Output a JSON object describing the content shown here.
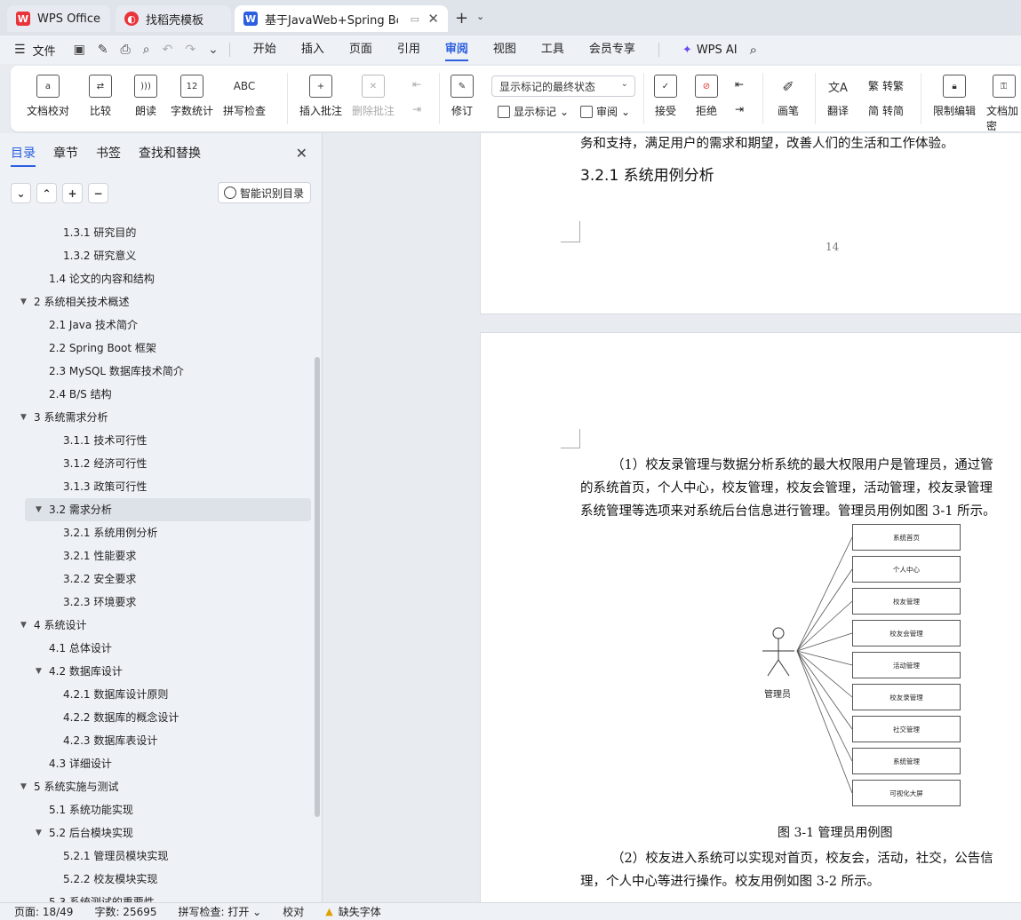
{
  "tabs": [
    {
      "label": "WPS Office"
    },
    {
      "label": "找稻壳模板"
    },
    {
      "label": "基于JavaWeb+Spring Boot的"
    }
  ],
  "menu": {
    "file": "文件",
    "items": [
      "开始",
      "插入",
      "页面",
      "引用",
      "审阅",
      "视图",
      "工具",
      "会员专享"
    ],
    "active": "审阅",
    "ai": "WPS AI"
  },
  "ribbon": {
    "doc_check": "文档校对",
    "compare": "比较",
    "read_aloud": "朗读",
    "word_count": "字数统计",
    "spell_check": "拼写检查",
    "insert_comment": "插入批注",
    "delete_comment": "删除批注",
    "revise": "修订",
    "markup_state": "显示标记的最终状态",
    "show_markup": "显示标记",
    "review": "审阅",
    "accept": "接受",
    "reject": "拒绝",
    "pen": "画笔",
    "translate": "翻译",
    "to_traditional": "转繁",
    "to_simplified": "转简",
    "restrict_edit": "限制编辑",
    "doc_encrypt": "文档加密",
    "abc_label": "ABC",
    "count_label": "12"
  },
  "sidebar": {
    "tabs": [
      "目录",
      "章节",
      "书签",
      "查找和替换"
    ],
    "smart_toc": "智能识别目录",
    "toc": [
      {
        "label": "1.3.1 研究目的",
        "level": 3
      },
      {
        "label": "1.3.2 研究意义",
        "level": 3
      },
      {
        "label": "1.4 论文的内容和结构",
        "level": 2
      },
      {
        "label": "2 系统相关技术概述",
        "level": 1,
        "expanded": true
      },
      {
        "label": "2.1 Java 技术简介",
        "level": 2
      },
      {
        "label": "2.2 Spring Boot 框架",
        "level": 2
      },
      {
        "label": "2.3 MySQL 数据库技术简介",
        "level": 2
      },
      {
        "label": "2.4 B/S 结构",
        "level": 2
      },
      {
        "label": "3 系统需求分析",
        "level": 1,
        "expanded": true
      },
      {
        "label": "3.1.1 技术可行性",
        "level": 3
      },
      {
        "label": "3.1.2 经济可行性",
        "level": 3
      },
      {
        "label": "3.1.3 政策可行性",
        "level": 3
      },
      {
        "label": "3.2 需求分析",
        "level": 2,
        "expanded": true,
        "selected": true
      },
      {
        "label": "3.2.1 系统用例分析",
        "level": 3
      },
      {
        "label": "3.2.1 性能要求",
        "level": 3
      },
      {
        "label": "3.2.2 安全要求",
        "level": 3
      },
      {
        "label": "3.2.3 环境要求",
        "level": 3
      },
      {
        "label": "4  系统设计",
        "level": 1,
        "expanded": true
      },
      {
        "label": "4.1 总体设计",
        "level": 2
      },
      {
        "label": "4.2 数据库设计",
        "level": 2,
        "expanded": true
      },
      {
        "label": "4.2.1 数据库设计原则",
        "level": 3
      },
      {
        "label": "4.2.2 数据库的概念设计",
        "level": 3
      },
      {
        "label": "4.2.3 数据库表设计",
        "level": 3
      },
      {
        "label": "4.3 详细设计",
        "level": 2
      },
      {
        "label": "5 系统实施与测试",
        "level": 1,
        "expanded": true
      },
      {
        "label": "5.1 系统功能实现",
        "level": 2
      },
      {
        "label": "5.2 后台模块实现",
        "level": 2,
        "expanded": true
      },
      {
        "label": "5.2.1 管理员模块实现",
        "level": 3
      },
      {
        "label": "5.2.2 校友模块实现",
        "level": 3
      },
      {
        "label": "5.3 系统测试的重要性",
        "level": 2
      }
    ]
  },
  "document": {
    "p1_line": "务和支持，满足用户的需求和期望，改善人们的生活和工作体验。",
    "p1_heading": "3.2.1 系统用例分析",
    "page_number": "14",
    "p2_lines": [
      "（1）校友录管理与数据分析系统的最大权限用户是管理员，通过管",
      "的系统首页，个人中心，校友管理，校友会管理，活动管理，校友录管理",
      "系统管理等选项来对系统后台信息进行管理。管理员用例如图 3-1 所示。"
    ],
    "actor": "管理员",
    "use_cases": [
      "系统首页",
      "个人中心",
      "校友管理",
      "校友会管理",
      "活动管理",
      "校友录管理",
      "社交管理",
      "系统管理",
      "可视化大屏"
    ],
    "figure_caption": "图 3-1 管理员用例图",
    "p3_lines": [
      "（2）校友进入系统可以实现对首页，校友会，活动，社交，公告信",
      "理，个人中心等进行操作。校友用例如图 3-2 所示。"
    ]
  },
  "status": {
    "page": "页面: 18/49",
    "words": "字数: 25695",
    "spell": "拼写检查: 打开",
    "proof": "校对",
    "missing_font": "缺失字体"
  },
  "colors": {
    "accent": "#2b5fe0",
    "wps_red": "#e8343a"
  }
}
